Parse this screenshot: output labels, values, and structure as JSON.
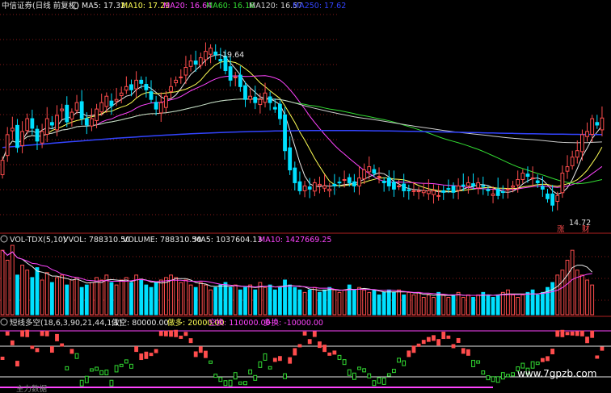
{
  "colors": {
    "up": "#ff4d4d",
    "down": "#00e0ff",
    "green": "#33dd33",
    "white": "#e8e8e8",
    "yellow": "#ffff55",
    "magenta": "#ff44ff",
    "blue": "#3344ff",
    "grid": "#8a1a1a",
    "text": "#d0d0d0"
  },
  "header": {
    "title": "中信证券(日线 前复权)",
    "ma5": "MA5: 17.32",
    "ma10": "MA10: 17.29",
    "ma20": "MA20: 16.64",
    "ma60": "MA60: 16.16",
    "ma120": "MA120: 16.57",
    "ma250": "MA250: 17.62"
  },
  "price_annotations": {
    "high": "19.64",
    "low": "14.72",
    "zhang_marker": "涨",
    "cai_marker": "财"
  },
  "volume_header": {
    "name": "VOL-TDX(5,10)",
    "vvol": "VVOL: 788310.50",
    "volume": "VOLUME: 788310.50",
    "ma5": "MA5: 1037604.13",
    "ma10": "MA10: 1427669.25"
  },
  "indicator_header": {
    "name": "短线多空(18,6,3,90,21,44,1,1)",
    "zuokong": "做空: 80000.00",
    "zuoduo": "做多: 20000.00",
    "kongdan": "空换: 110000.00",
    "duodan": "多换: -10000.00"
  },
  "footer": {
    "partial_text": "主力数据",
    "watermark": "www.7gpzb.com"
  },
  "chart_data": [
    {
      "type": "candlestick",
      "title": "中信证券(日线 前复权)",
      "ylim": [
        13.8,
        20.6
      ],
      "annotations": [
        "19.64",
        "14.72"
      ],
      "close": [
        16.0,
        16.8,
        17.0,
        16.4,
        16.9,
        17.3,
        17.0,
        16.6,
        16.9,
        17.3,
        17.1,
        17.4,
        17.6,
        17.2,
        17.5,
        17.8,
        17.3,
        17.1,
        17.3,
        17.6,
        17.8,
        18.0,
        17.7,
        17.9,
        18.1,
        18.3,
        18.2,
        18.5,
        18.4,
        18.2,
        17.9,
        17.6,
        17.8,
        18.0,
        18.3,
        18.5,
        18.6,
        18.9,
        19.1,
        19.0,
        19.2,
        19.4,
        19.5,
        19.3,
        19.1,
        18.8,
        18.5,
        18.6,
        18.3,
        17.9,
        18.0,
        17.8,
        17.9,
        18.1,
        17.8,
        17.6,
        17.3,
        16.3,
        15.7,
        15.3,
        15.05,
        15.2,
        15.1,
        15.3,
        15.25,
        15.2,
        15.1,
        15.2,
        15.3,
        15.4,
        15.3,
        15.2,
        15.45,
        15.7,
        15.8,
        15.6,
        15.5,
        15.3,
        15.2,
        15.1,
        15.2,
        15.05,
        15.05,
        15.05,
        15.05,
        15.05,
        15.05,
        15.05,
        14.9,
        15.0,
        15.1,
        15.0,
        15.2,
        15.2,
        15.3,
        15.2,
        15.3,
        15.2,
        15.05,
        14.95,
        14.9,
        15.0,
        15.1,
        15.2,
        15.4,
        15.6,
        15.5,
        15.45,
        15.3,
        15.1,
        14.8,
        14.6,
        14.9,
        15.6,
        15.8,
        16.1,
        16.3,
        16.8,
        16.9,
        17.3,
        17.1,
        17.32
      ]
    },
    {
      "type": "bar",
      "title": "VOL-TDX(5,10)",
      "values": [
        2.6,
        2.2,
        2.8,
        1.6,
        2.0,
        1.8,
        1.5,
        1.9,
        1.4,
        1.7,
        1.3,
        1.5,
        1.6,
        1.2,
        1.4,
        1.5,
        1.1,
        1.2,
        1.3,
        1.5,
        1.4,
        1.6,
        1.3,
        1.2,
        1.4,
        1.5,
        1.3,
        1.6,
        1.4,
        1.2,
        1.1,
        1.3,
        1.4,
        1.5,
        1.6,
        1.5,
        1.3,
        1.4,
        1.2,
        1.1,
        1.3,
        1.2,
        1.0,
        1.1,
        1.2,
        1.3,
        1.1,
        1.2,
        1.0,
        1.1,
        1.2,
        1.0,
        1.3,
        1.1,
        1.2,
        1.0,
        1.1,
        1.4,
        1.2,
        1.1,
        1.0,
        0.9,
        1.0,
        1.1,
        0.9,
        1.0,
        1.1,
        1.0,
        0.9,
        1.0,
        1.2,
        1.0,
        1.1,
        1.0,
        0.9,
        1.0,
        0.8,
        0.9,
        1.0,
        0.9,
        1.0,
        0.8,
        0.9,
        0.8,
        0.9,
        0.7,
        0.8,
        0.7,
        0.9,
        0.8,
        0.7,
        0.8,
        0.9,
        0.7,
        0.8,
        0.7,
        0.8,
        0.9,
        0.8,
        0.7,
        0.8,
        0.9,
        1.0,
        0.8,
        0.7,
        0.8,
        0.9,
        1.0,
        0.8,
        0.9,
        1.1,
        1.3,
        1.6,
        1.8,
        2.2,
        2.6,
        1.8,
        1.6,
        1.4,
        1.2
      ]
    },
    {
      "type": "line",
      "title": "短线多空(18,6,3,90,21,44,1,1)",
      "series": [
        {
          "name": "做空",
          "values": [
            80000
          ]
        },
        {
          "name": "做多",
          "values": [
            20000
          ]
        },
        {
          "name": "空换",
          "values": [
            110000
          ]
        },
        {
          "name": "多换",
          "values": [
            -10000
          ]
        }
      ]
    }
  ]
}
